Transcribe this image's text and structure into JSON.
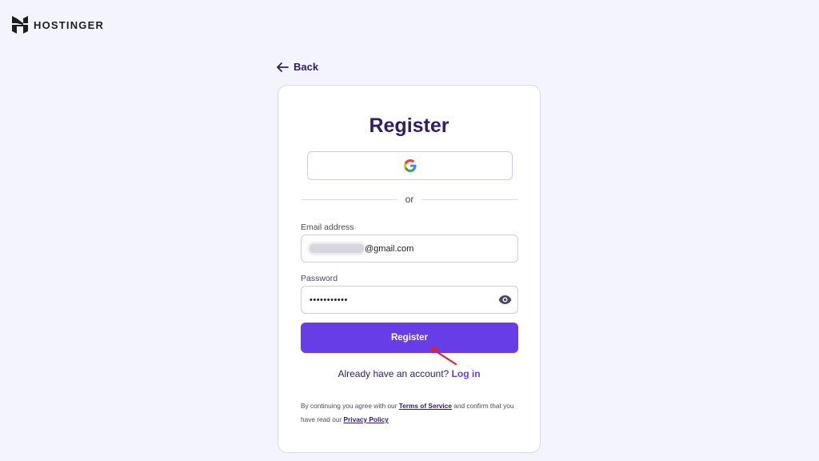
{
  "brand": {
    "name": "HOSTINGER"
  },
  "nav": {
    "back_label": "Back"
  },
  "form": {
    "title": "Register",
    "google_icon": "google-icon",
    "divider_text": "or",
    "email": {
      "label": "Email address",
      "value_visible": "@gmail.com"
    },
    "password": {
      "label": "Password",
      "value_masked": "•••••••••••",
      "toggle_icon": "eye-icon"
    },
    "submit_label": "Register",
    "login_prompt": "Already have an account?",
    "login_link": "Log in",
    "terms": {
      "prefix": "By continuing you agree with our",
      "tos_link": "Terms of Service",
      "middle": "and confirm that you have read our",
      "privacy_link": "Privacy Policy"
    }
  },
  "colors": {
    "accent": "#673de6",
    "heading": "#2f1c6a",
    "background": "#f4f4ff",
    "annotation_arrow": "#e0202a"
  }
}
